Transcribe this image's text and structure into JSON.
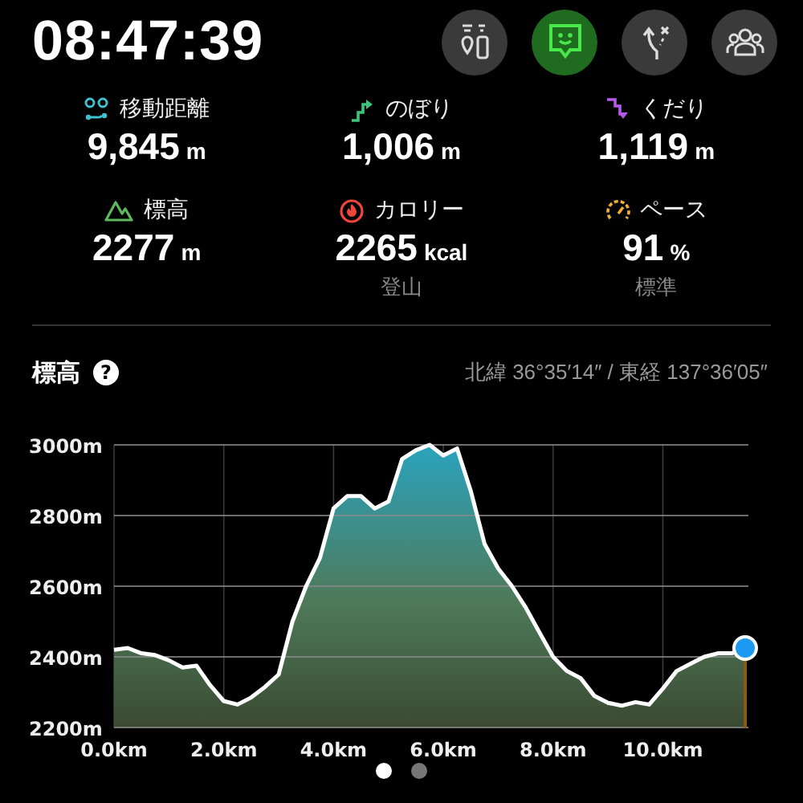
{
  "clock": "08:47:39",
  "toolbar": [
    {
      "kind": "gear",
      "selected": false
    },
    {
      "kind": "face",
      "selected": true
    },
    {
      "kind": "route",
      "selected": false
    },
    {
      "kind": "group",
      "selected": false
    }
  ],
  "stats": [
    {
      "kind": "distance",
      "label": "移動距離",
      "value": "9,845",
      "unit": "m",
      "color": "#3fc1d0"
    },
    {
      "kind": "ascent",
      "label": "のぼり",
      "value": "1,006",
      "unit": "m",
      "color": "#3ec47a"
    },
    {
      "kind": "descent",
      "label": "くだり",
      "value": "1,119",
      "unit": "m",
      "color": "#b45ae8"
    },
    {
      "kind": "elevation",
      "label": "標高",
      "value": "2277",
      "unit": "m",
      "color": "#5cb85c"
    },
    {
      "kind": "calorie",
      "label": "カロリー",
      "value": "2265",
      "unit": "kcal",
      "sub": "登山",
      "color": "#f0463c"
    },
    {
      "kind": "pace",
      "label": "ペース",
      "value": "91",
      "unit": "%",
      "sub": "標準",
      "color": "#f0b030"
    }
  ],
  "elevation_panel": {
    "title": "標高",
    "help": "?",
    "coordinates": "北緯 36°35′14″ / 東経 137°36′05″",
    "chart_data": {
      "type": "area",
      "grid": true,
      "ylim": [
        2200,
        3000
      ],
      "xlim": [
        0,
        11.5
      ],
      "yticks": [
        {
          "value": 2200,
          "label": "2200m"
        },
        {
          "value": 2400,
          "label": "2400m"
        },
        {
          "value": 2600,
          "label": "2600m"
        },
        {
          "value": 2800,
          "label": "2800m"
        },
        {
          "value": 3000,
          "label": "3000m"
        }
      ],
      "xticks": [
        {
          "value": 0,
          "label": "0.0km"
        },
        {
          "value": 2,
          "label": "2.0km"
        },
        {
          "value": 4,
          "label": "4.0km"
        },
        {
          "value": 6,
          "label": "6.0km"
        },
        {
          "value": 8,
          "label": "8.0km"
        },
        {
          "value": 10,
          "label": "10.0km"
        }
      ],
      "x": [
        0,
        0.25,
        0.5,
        0.75,
        1,
        1.25,
        1.5,
        1.75,
        2,
        2.25,
        2.5,
        2.75,
        3,
        3.25,
        3.5,
        3.75,
        4,
        4.25,
        4.5,
        4.75,
        5,
        5.25,
        5.5,
        5.75,
        6,
        6.25,
        6.5,
        6.75,
        7,
        7.25,
        7.5,
        7.75,
        8,
        8.25,
        8.5,
        8.75,
        9,
        9.25,
        9.5,
        9.75,
        10,
        10.25,
        10.5,
        10.75,
        11,
        11.25,
        11.5
      ],
      "series": [
        {
          "color": "#ffffff",
          "values": [
            2420,
            2425,
            2410,
            2405,
            2390,
            2370,
            2375,
            2320,
            2275,
            2265,
            2285,
            2315,
            2350,
            2500,
            2600,
            2680,
            2820,
            2855,
            2855,
            2820,
            2840,
            2960,
            2985,
            3000,
            2970,
            2990,
            2870,
            2720,
            2650,
            2600,
            2540,
            2470,
            2400,
            2360,
            2340,
            2290,
            2270,
            2262,
            2272,
            2265,
            2310,
            2360,
            2380,
            2400,
            2410,
            2410,
            2425
          ]
        }
      ]
    }
  },
  "pager": [
    {
      "selected": true
    },
    {
      "selected": false
    }
  ]
}
